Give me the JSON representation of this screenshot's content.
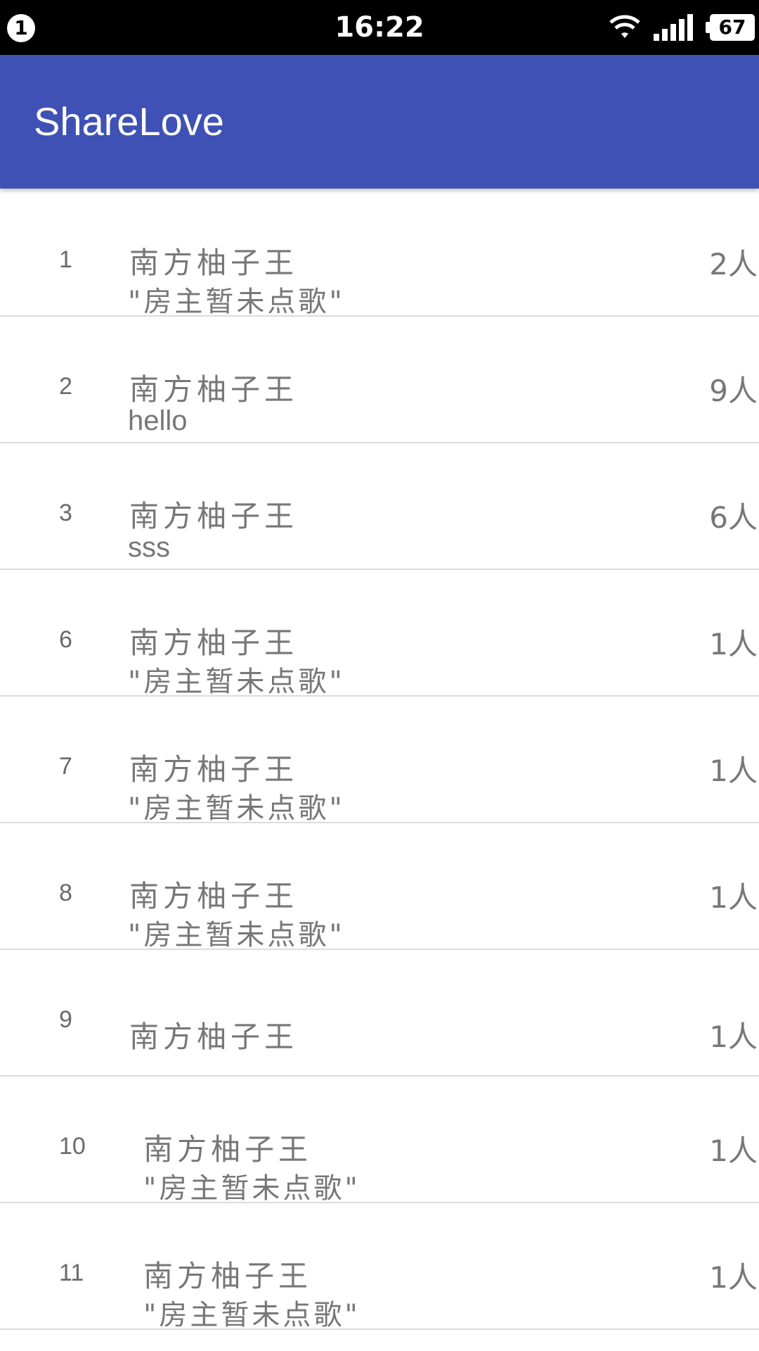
{
  "status_bar": {
    "notification_count": "1",
    "time": "16:22",
    "wifi_icon": "wifi-icon",
    "signal_icon": "signal-icon",
    "battery_level": "67"
  },
  "app_bar": {
    "title": "ShareLove",
    "color": "#3f51b5"
  },
  "rooms": [
    {
      "number": "1",
      "name": "南方柚子王",
      "song": "\"房主暂未点歌\"",
      "count": "2人"
    },
    {
      "number": "2",
      "name": "南方柚子王",
      "song": "hello",
      "count": "9人"
    },
    {
      "number": "3",
      "name": "南方柚子王",
      "song": "sss",
      "count": "6人"
    },
    {
      "number": "6",
      "name": "南方柚子王",
      "song": "\"房主暂未点歌\"",
      "count": "1人"
    },
    {
      "number": "7",
      "name": "南方柚子王",
      "song": "\"房主暂未点歌\"",
      "count": "1人"
    },
    {
      "number": "8",
      "name": "南方柚子王",
      "song": "\"房主暂未点歌\"",
      "count": "1人"
    },
    {
      "number": "9",
      "name": "南方柚子王",
      "song": "",
      "count": "1人"
    },
    {
      "number": "10",
      "name": "南方柚子王",
      "song": "\"房主暂未点歌\"",
      "count": "1人"
    },
    {
      "number": "11",
      "name": "南方柚子王",
      "song": "\"房主暂未点歌\"",
      "count": "1人"
    }
  ]
}
